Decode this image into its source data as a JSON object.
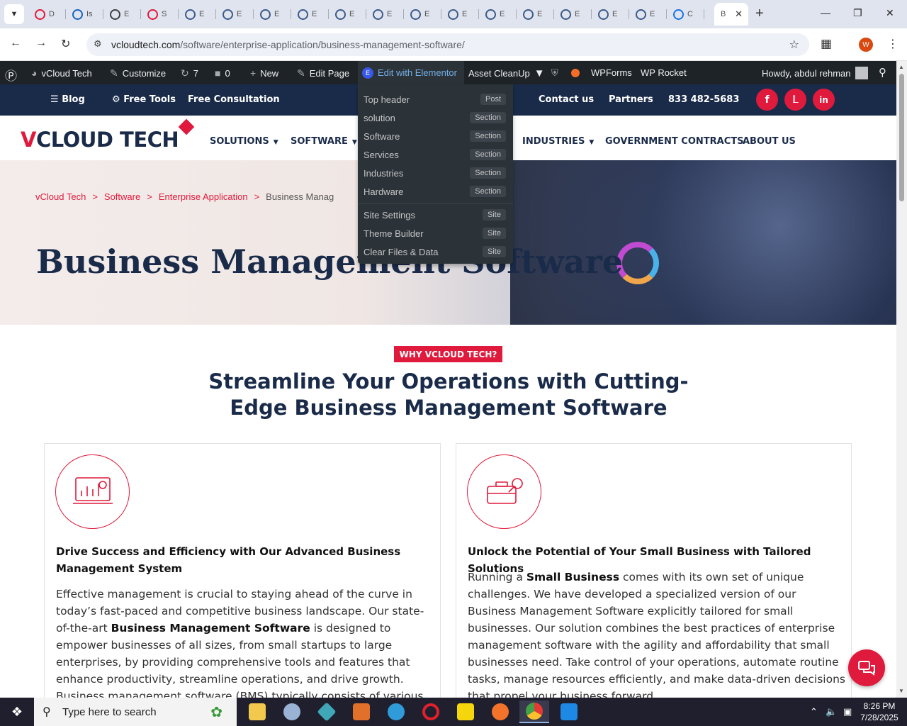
{
  "browser": {
    "tabs": [
      {
        "label": "D",
        "color": "#e01a3c"
      },
      {
        "label": "Is",
        "color": "#1565c0"
      },
      {
        "label": "E",
        "color": "#3c4043"
      },
      {
        "label": "S",
        "color": "#e01a3c"
      },
      {
        "label": "E",
        "color": "#3c5a8a"
      },
      {
        "label": "E",
        "color": "#3c5a8a"
      },
      {
        "label": "E",
        "color": "#3c5a8a"
      },
      {
        "label": "E",
        "color": "#3c5a8a"
      },
      {
        "label": "E",
        "color": "#3c5a8a"
      },
      {
        "label": "E",
        "color": "#3c5a8a"
      },
      {
        "label": "E",
        "color": "#3c5a8a"
      },
      {
        "label": "E",
        "color": "#3c5a8a"
      },
      {
        "label": "E",
        "color": "#3c5a8a"
      },
      {
        "label": "E",
        "color": "#3c5a8a"
      },
      {
        "label": "E",
        "color": "#3c5a8a"
      },
      {
        "label": "E",
        "color": "#3c5a8a"
      },
      {
        "label": "E",
        "color": "#3c5a8a"
      },
      {
        "label": "C",
        "color": "#1a73e8"
      }
    ],
    "active_tab_label": "B",
    "url_host": "vcloudtech.com",
    "url_path": "/software/enterprise-application/business-management-software/",
    "profile_initial": "W"
  },
  "adminbar": {
    "site_name": "vCloud Tech",
    "customize": "Customize",
    "updates_count": "7",
    "comments_count": "0",
    "new_label": "New",
    "edit_page": "Edit Page",
    "edit_elementor": "Edit with Elementor",
    "asset_cleanup": "Asset CleanUp",
    "wpforms": "WPForms",
    "wp_rocket": "WP Rocket",
    "howdy": "Howdy, abdul rehman"
  },
  "elementor_menu": {
    "items": [
      {
        "label": "Top header",
        "badge": "Post"
      },
      {
        "label": "solution",
        "badge": "Section"
      },
      {
        "label": "Software",
        "badge": "Section"
      },
      {
        "label": "Services",
        "badge": "Section"
      },
      {
        "label": "Industries",
        "badge": "Section"
      },
      {
        "label": "Hardware",
        "badge": "Section"
      },
      {
        "label": "Site Settings",
        "badge": "Site"
      },
      {
        "label": "Theme Builder",
        "badge": "Site"
      },
      {
        "label": "Clear Files & Data",
        "badge": "Site"
      }
    ]
  },
  "site_header": {
    "blog": "Blog",
    "free_tools": "Free Tools",
    "free_consultation": "Free Consultation",
    "contact_us": "Contact us",
    "partners": "Partners",
    "phone": "833 482-5683"
  },
  "nav": {
    "logo_v": "V",
    "logo_rest": "CLOUD TECH",
    "solutions": "SOLUTIONS",
    "software": "SOFTWARE",
    "industries": "INDUSTRIES",
    "government": "GOVERNMENT CONTRACTS",
    "about": "ABOUT US"
  },
  "hero": {
    "crumb1": "vCloud Tech",
    "crumb2": "Software",
    "crumb3": "Enterprise Application",
    "crumb_current": "Business Manag",
    "separator": ">",
    "title": "Business Management Software"
  },
  "main": {
    "why_badge": "WHY VCLOUD TECH?",
    "section_title_line1": "Streamline Your Operations with Cutting-",
    "section_title_line2": "Edge Business Management Software",
    "card1": {
      "title": "Drive Success and Efficiency with Our Advanced Business Management System",
      "body_1": "Effective management is crucial to staying ahead of the curve in today’s fast-paced and competitive business landscape. Our state-of-the-art ",
      "body_bold": "Business Management Software",
      "body_2": " is designed to empower businesses of all sizes, from small startups to large enterprises, by providing comprehensive tools and features that enhance productivity, streamline operations, and drive growth. Business management software (BMS) typically consists of various modules"
    },
    "card2": {
      "title": "Unlock the Potential of Your Small Business with Tailored Solutions",
      "body_1": "Running a ",
      "body_bold": "Small Business",
      "body_2": " comes with its own set of unique challenges. We have developed a specialized version of our Business Management Software explicitly tailored for small businesses. Our solution combines the best practices of enterprise management software with the agility and affordability that small businesses need. Take control of your operations, automate routine tasks, manage resources efficiently, and make data-driven decisions that propel your business forward."
    }
  },
  "taskbar": {
    "search_placeholder": "Type here to search",
    "time": "8:26 PM",
    "date": "7/28/2025"
  },
  "colors": {
    "brand_red": "#e01a3c",
    "brand_navy": "#1a2b4a",
    "admin_bar": "#1d2327"
  }
}
